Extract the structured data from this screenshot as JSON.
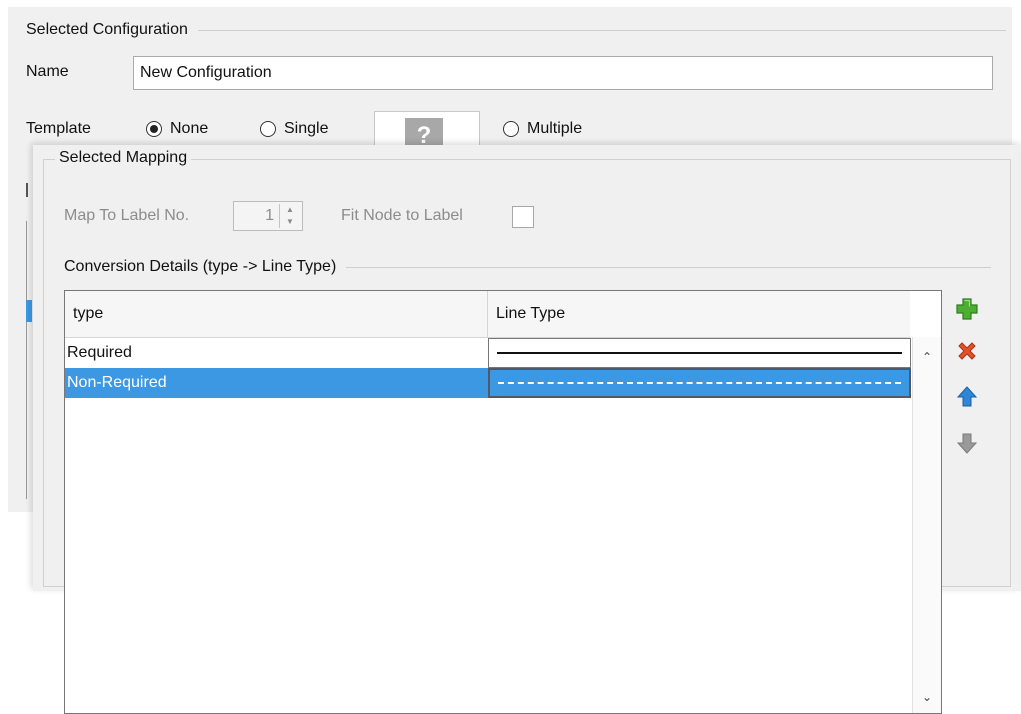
{
  "config": {
    "group_title": "Selected Configuration",
    "name_label": "Name",
    "name_value": "New Configuration",
    "template_label": "Template",
    "template_options": [
      {
        "label": "None",
        "selected": true
      },
      {
        "label": "Single",
        "selected": false
      },
      {
        "label": "Multiple",
        "selected": false
      }
    ],
    "template_preview_icon": "question-mark-icon",
    "template_preview_glyph": "?"
  },
  "mapping": {
    "group_title": "Selected Mapping",
    "map_to_label": "Map To Label No.",
    "map_to_value": "1",
    "fit_node_label": "Fit Node to Label",
    "fit_node_checked": false,
    "conversion_title": "Conversion Details (type -> Line Type)",
    "columns": [
      "type",
      "Line Type"
    ],
    "rows": [
      {
        "type": "Required",
        "line_style": "solid",
        "selected": false
      },
      {
        "type": "Non-Required",
        "line_style": "dashed",
        "selected": true
      }
    ],
    "actions": [
      {
        "icon": "add-plus-icon",
        "color": "#4caf32"
      },
      {
        "icon": "delete-x-icon",
        "color": "#e2512a"
      },
      {
        "icon": "move-up-arrow-icon",
        "color": "#2f86d6"
      },
      {
        "icon": "move-down-arrow-icon",
        "color": "#9a9a9a"
      }
    ],
    "selection_color": "#3d98e3"
  }
}
